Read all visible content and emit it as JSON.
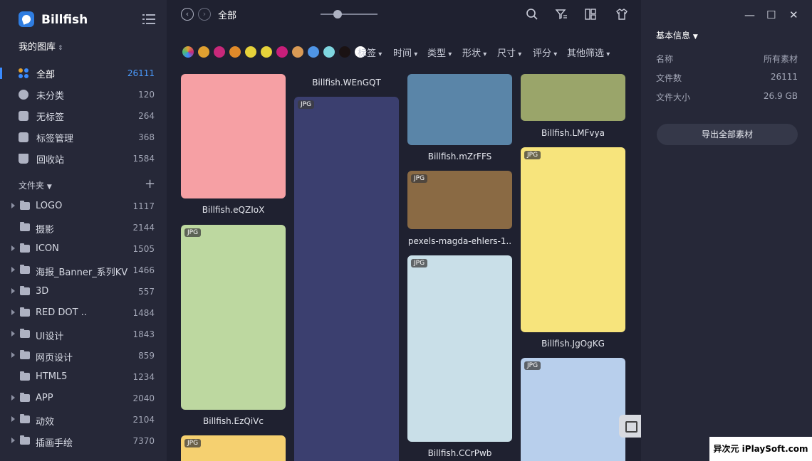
{
  "app": {
    "title": "Billfish",
    "library_label": "我的图库"
  },
  "nav": [
    {
      "label": "全部",
      "count": "26111",
      "active": true
    },
    {
      "label": "未分类",
      "count": "120"
    },
    {
      "label": "无标签",
      "count": "264"
    },
    {
      "label": "标签管理",
      "count": "368"
    },
    {
      "label": "回收站",
      "count": "1584"
    }
  ],
  "folders_header": "文件夹",
  "folders": [
    {
      "label": "LOGO",
      "count": "1117",
      "expandable": true
    },
    {
      "label": "摄影",
      "count": "2144",
      "expandable": false
    },
    {
      "label": "ICON",
      "count": "1505",
      "expandable": true
    },
    {
      "label": "海报_Banner_系列KV",
      "count": "1466",
      "expandable": true
    },
    {
      "label": "3D",
      "count": "557",
      "expandable": true
    },
    {
      "label": "RED DOT ..",
      "count": "1484",
      "expandable": true
    },
    {
      "label": "UI设计",
      "count": "1843",
      "expandable": true
    },
    {
      "label": "网页设计",
      "count": "859",
      "expandable": true
    },
    {
      "label": "HTML5",
      "count": "1234",
      "expandable": false
    },
    {
      "label": "APP",
      "count": "2040",
      "expandable": true
    },
    {
      "label": "动效",
      "count": "2104",
      "expandable": true
    },
    {
      "label": "插画手绘",
      "count": "7370",
      "expandable": true
    }
  ],
  "toolbar": {
    "breadcrumb": "全部",
    "back_icon": "chevron-left-icon",
    "forward_icon": "chevron-right-icon"
  },
  "color_filters": [
    "#e0a030",
    "#c8287a",
    "#e08a2a",
    "#e6d23a",
    "#e6d23a",
    "#c81e7a",
    "#d99a55",
    "#4f95e6",
    "#7fd6e0",
    "#1a1213",
    "#ffffff"
  ],
  "filters": [
    "标签",
    "时间",
    "类型",
    "形状",
    "尺寸",
    "评分",
    "其他筛选"
  ],
  "cards": [
    {
      "name": "Billfish.eQZIoX",
      "tag": "",
      "color": "#f6a0a4"
    },
    {
      "name": "Billfish.EzQiVc",
      "tag": "JPG",
      "color": "#bdd8a0"
    },
    {
      "name": "",
      "tag": "JPG",
      "color": "#f5d070"
    },
    {
      "name": "Billfish.WEnGQT",
      "tag": "",
      "color": ""
    },
    {
      "name": "",
      "tag": "JPG",
      "color": "#3b3f6f"
    },
    {
      "name": "Billfish.mZrFFS",
      "tag": "",
      "color": "#5a85a8"
    },
    {
      "name": "pexels-magda-ehlers-1..",
      "tag": "JPG",
      "color": "#8a6a44"
    },
    {
      "name": "Billfish.CCrPwb",
      "tag": "JPG",
      "color": "#c9dfe8"
    },
    {
      "name": "Billfish.LMFvya",
      "tag": "",
      "color": "#9aa56a"
    },
    {
      "name": "Billfish.JgOgKG",
      "tag": "JPG",
      "color": "#f7e47c"
    },
    {
      "name": "",
      "tag": "JPG",
      "color": "#b8cfec"
    }
  ],
  "info": {
    "title": "基本信息",
    "rows": [
      {
        "label": "名称",
        "value": "所有素材"
      },
      {
        "label": "文件数",
        "value": "26111"
      },
      {
        "label": "文件大小",
        "value": "26.9 GB"
      }
    ],
    "export_label": "导出全部素材"
  },
  "watermark": "异次元 iPlaySoft.com"
}
